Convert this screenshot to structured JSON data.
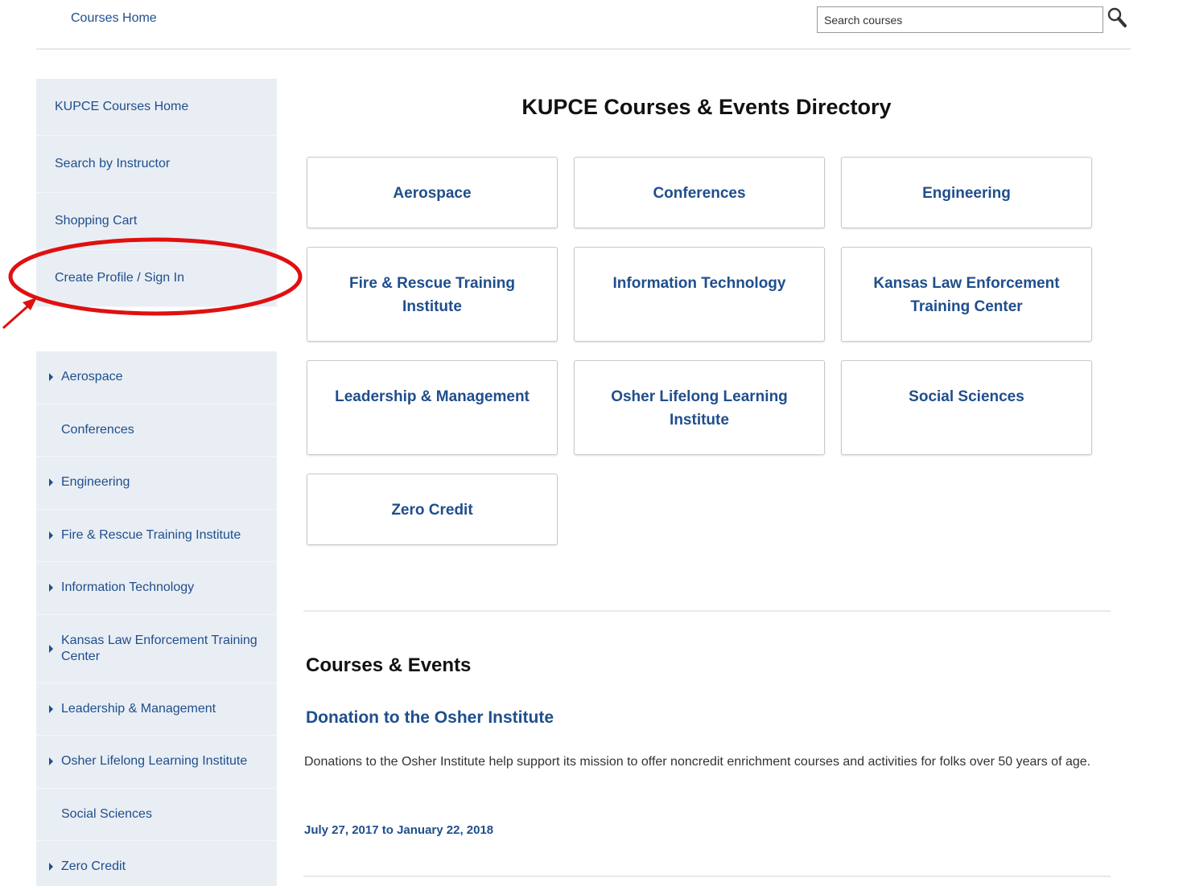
{
  "header": {
    "home_link": "Courses Home",
    "search_placeholder": "Search courses"
  },
  "sidebar_top": [
    {
      "label": "KUPCE Courses Home"
    },
    {
      "label": "Search by Instructor"
    },
    {
      "label": "Shopping Cart"
    },
    {
      "label": "Create Profile / Sign In"
    }
  ],
  "sidebar_categories": [
    {
      "label": "Aerospace",
      "expandable": true
    },
    {
      "label": "Conferences",
      "expandable": false
    },
    {
      "label": "Engineering",
      "expandable": true
    },
    {
      "label": "Fire & Rescue Training Institute",
      "expandable": true
    },
    {
      "label": "Information Technology",
      "expandable": true
    },
    {
      "label": "Kansas Law Enforcement Training Center",
      "expandable": true
    },
    {
      "label": "Leadership & Management",
      "expandable": true
    },
    {
      "label": "Osher Lifelong Learning Institute",
      "expandable": true
    },
    {
      "label": "Social Sciences",
      "expandable": false
    },
    {
      "label": "Zero Credit",
      "expandable": true
    }
  ],
  "main": {
    "title": "KUPCE Courses & Events Directory",
    "tiles": [
      {
        "line1": "Aerospace",
        "line2": ""
      },
      {
        "line1": "Conferences",
        "line2": ""
      },
      {
        "line1": "Engineering",
        "line2": ""
      },
      {
        "line1": "Fire & Rescue Training",
        "line2": "Institute"
      },
      {
        "line1": "Information Technology",
        "line2": ""
      },
      {
        "line1": "Kansas Law Enforcement",
        "line2": "Training Center"
      },
      {
        "line1": "Leadership & Management",
        "line2": ""
      },
      {
        "line1": "Osher Lifelong Learning",
        "line2": "Institute"
      },
      {
        "line1": "Social Sciences",
        "line2": ""
      },
      {
        "line1": "Zero Credit",
        "line2": ""
      }
    ],
    "section_title": "Courses & Events",
    "event": {
      "title": "Donation to the Osher Institute",
      "description": "Donations to the Osher Institute help support its mission to offer noncredit enrichment courses and activities for folks over 50 years of age.",
      "date": "July 27, 2017 to January 22, 2018"
    }
  },
  "colors": {
    "link_blue": "#1f4e8c",
    "sidebar_bg": "#e9eef4",
    "annotation_red": "#e01010"
  },
  "icons": {
    "search": "search-icon",
    "caret": "caret-right-icon"
  }
}
